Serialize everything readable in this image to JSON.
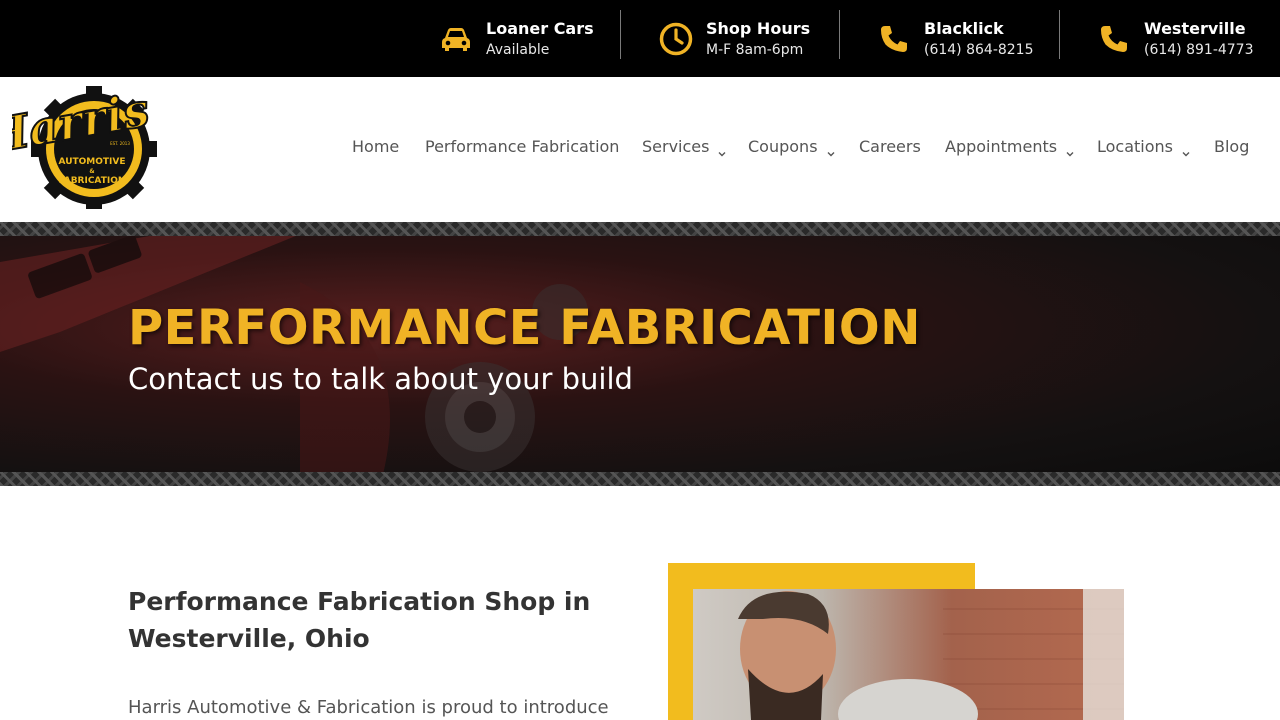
{
  "topbar": {
    "items": [
      {
        "icon": "car-icon",
        "title": "Loaner Cars",
        "subtitle": "Available"
      },
      {
        "icon": "clock-icon",
        "title": "Shop Hours",
        "subtitle": "M-F 8am-6pm"
      },
      {
        "icon": "phone-icon",
        "title": "Blacklick",
        "subtitle": "(614) 864-8215"
      },
      {
        "icon": "phone-icon",
        "title": "Westerville",
        "subtitle": "(614) 891-4773"
      }
    ]
  },
  "logo": {
    "script_text": "Harris",
    "line1": "AUTOMOTIVE",
    "line2": "&",
    "line3": "FABRICATION",
    "est": "EST. 2013"
  },
  "nav": {
    "items": [
      {
        "label": "Home",
        "dropdown": false
      },
      {
        "label": "Performance Fabrication",
        "dropdown": false
      },
      {
        "label": "Services",
        "dropdown": true
      },
      {
        "label": "Coupons",
        "dropdown": true
      },
      {
        "label": "Careers",
        "dropdown": false
      },
      {
        "label": "Appointments",
        "dropdown": true
      },
      {
        "label": "Locations",
        "dropdown": true
      },
      {
        "label": "Blog",
        "dropdown": false
      }
    ]
  },
  "hero": {
    "title": "PERFORMANCE FABRICATION",
    "subtitle": "Contact us to talk about your build"
  },
  "content": {
    "heading": "Performance Fabrication Shop in Westerville, Ohio",
    "paragraph": "Harris Automotive & Fabrication is proud to introduce"
  },
  "colors": {
    "accent": "#f0b325",
    "topbar_bg": "#000000",
    "frame": "#f2bc1e"
  }
}
